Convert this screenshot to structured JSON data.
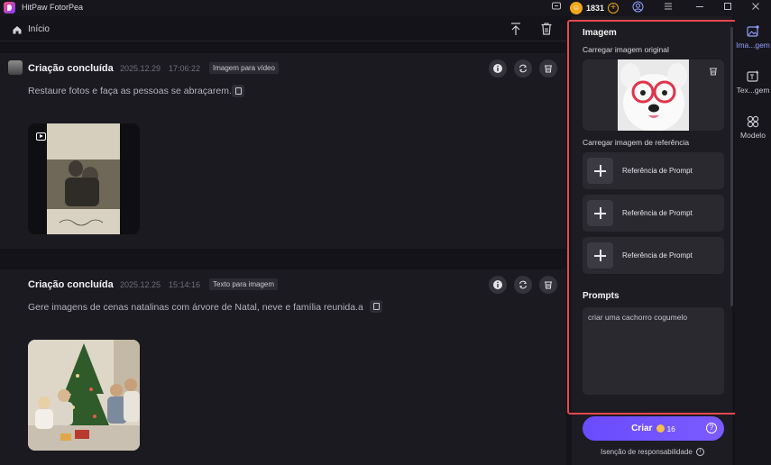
{
  "window": {
    "title": "HitPaw FotorPea",
    "credits": "1831",
    "coin_glyph": "☺"
  },
  "header": {
    "home_label": "Início"
  },
  "feed": [
    {
      "title": "Criação concluída",
      "date": "2025.12.29",
      "time": "17:06:22",
      "tag": "Imagem para vídeo",
      "prompt": "Restaure fotos e faça as pessoas se abraçarem.",
      "media": "video"
    },
    {
      "title": "Criação concluída",
      "date": "2025.12.25",
      "time": "15:14:16",
      "tag": "Texto para imagem",
      "prompt": "Gere imagens de cenas natalinas com árvore de Natal, neve e família reunida.a",
      "media": "image"
    }
  ],
  "panel": {
    "section_image": "Imagem",
    "upload_original": "Carregar imagem original",
    "upload_reference": "Carregar imagem de referência",
    "references": [
      "Referência de Prompt",
      "Referência de Prompt",
      "Referência de Prompt"
    ],
    "section_prompts": "Prompts",
    "prompt_value": "criar uma cachorro cogumelo",
    "create_label": "Criar",
    "create_cost": "16",
    "help_glyph": "?",
    "disclaimer": "Isenção de responsabilidade",
    "info_glyph": "i"
  },
  "rail": [
    {
      "label": "Ima...gem",
      "icon": "image-edit-icon"
    },
    {
      "label": "Tex...gem",
      "icon": "text-image-icon"
    },
    {
      "label": "Modelo",
      "icon": "model-grid-icon"
    }
  ],
  "colors": {
    "accent": "#6a4cff",
    "highlight": "#e5484d",
    "coin": "#f0a81a"
  }
}
